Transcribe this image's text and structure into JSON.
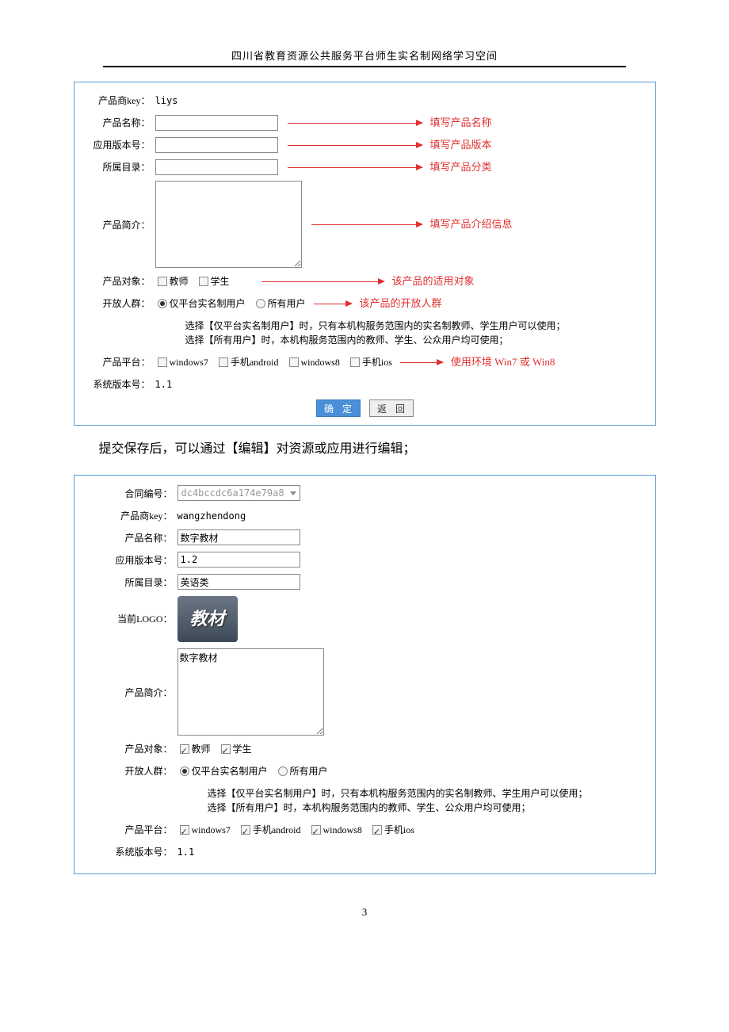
{
  "header": "四川省教育资源公共服务平台师生实名制网络学习空间",
  "body_text": "提交保存后，可以通过【编辑】对资源或应用进行编辑；",
  "page_number": "3",
  "form1": {
    "labels": {
      "vendor_key": "产品商key：",
      "name": "产品名称：",
      "version": "应用版本号：",
      "category": "所属目录：",
      "intro": "产品简介：",
      "target": "产品对象：",
      "open_to": "开放人群：",
      "platform": "产品平台：",
      "sys_version": "系统版本号："
    },
    "vendor_key": "liys",
    "name": "",
    "version": "",
    "category": "",
    "intro": "",
    "target_opts": {
      "teacher": "教师",
      "student": "学生"
    },
    "open_opts": {
      "real": "仅平台实名制用户",
      "all": "所有用户"
    },
    "platform_opts": {
      "w7": "windows7",
      "and": "手机android",
      "w8": "windows8",
      "ios": "手机ios"
    },
    "sys_version": "1.1",
    "note_l1": "选择【仅平台实名制用户】时，只有本机构服务范围内的实名制教师、学生用户可以使用；",
    "note_l2": "选择【所有用户】时，本机构服务范围内的教师、学生、公众用户均可使用；",
    "btn_ok": "确 定",
    "btn_back": "返 回",
    "anno": {
      "name": "填写产品名称",
      "version": "填写产品版本",
      "category": "填写产品分类",
      "intro": "填写产品介绍信息",
      "target": "该产品的适用对象",
      "open": "该产品的开放人群",
      "platform": "使用环境 Win7 或 Win8"
    }
  },
  "form2": {
    "labels": {
      "contract": "合同编号：",
      "vendor_key": "产品商key：",
      "name": "产品名称：",
      "version": "应用版本号：",
      "category": "所属目录：",
      "logo": "当前LOGO：",
      "intro": "产品简介：",
      "target": "产品对象：",
      "open_to": "开放人群：",
      "platform": "产品平台：",
      "sys_version": "系统版本号："
    },
    "contract": "dc4bccdc6a174e79a8",
    "vendor_key": "wangzhendong",
    "name": "数字教材",
    "version": "1.2",
    "category": "英语类",
    "logo_text": "教材",
    "intro": "数字教材",
    "target_opts": {
      "teacher": "教师",
      "student": "学生"
    },
    "open_opts": {
      "real": "仅平台实名制用户",
      "all": "所有用户"
    },
    "platform_opts": {
      "w7": "windows7",
      "and": "手机android",
      "w8": "windows8",
      "ios": "手机ios"
    },
    "sys_version": "1.1",
    "note_l1": "选择【仅平台实名制用户】时，只有本机构服务范围内的实名制教师、学生用户可以使用；",
    "note_l2": "选择【所有用户】时，本机构服务范围内的教师、学生、公众用户均可使用；"
  }
}
